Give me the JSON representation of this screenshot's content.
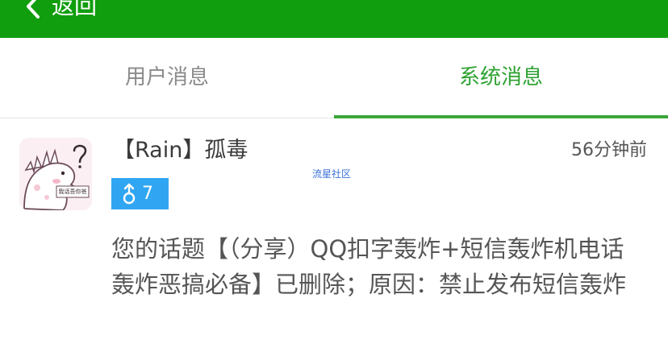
{
  "header": {
    "back_label": "返回",
    "background_color": "#109d0e",
    "back_icon": "chevron-left-icon"
  },
  "tabs": [
    {
      "label": "用户消息",
      "active": false
    },
    {
      "label": "系统消息",
      "active": true
    }
  ],
  "accent_color": "#2ea231",
  "message": {
    "avatar_icon": "dinosaur-avatar",
    "avatar_text": "我话吾你爸",
    "username": "【Rain】孤毒",
    "time": "56分钟前",
    "watermark": "流星社区",
    "badge": {
      "icon": "male-icon",
      "count": "7",
      "color": "#30a6f2"
    },
    "body": "您的话题【（分享）QQ扣字轰炸+短信轰炸机电话轰炸恶搞必备】已删除；原因：禁止发布短信轰炸"
  }
}
